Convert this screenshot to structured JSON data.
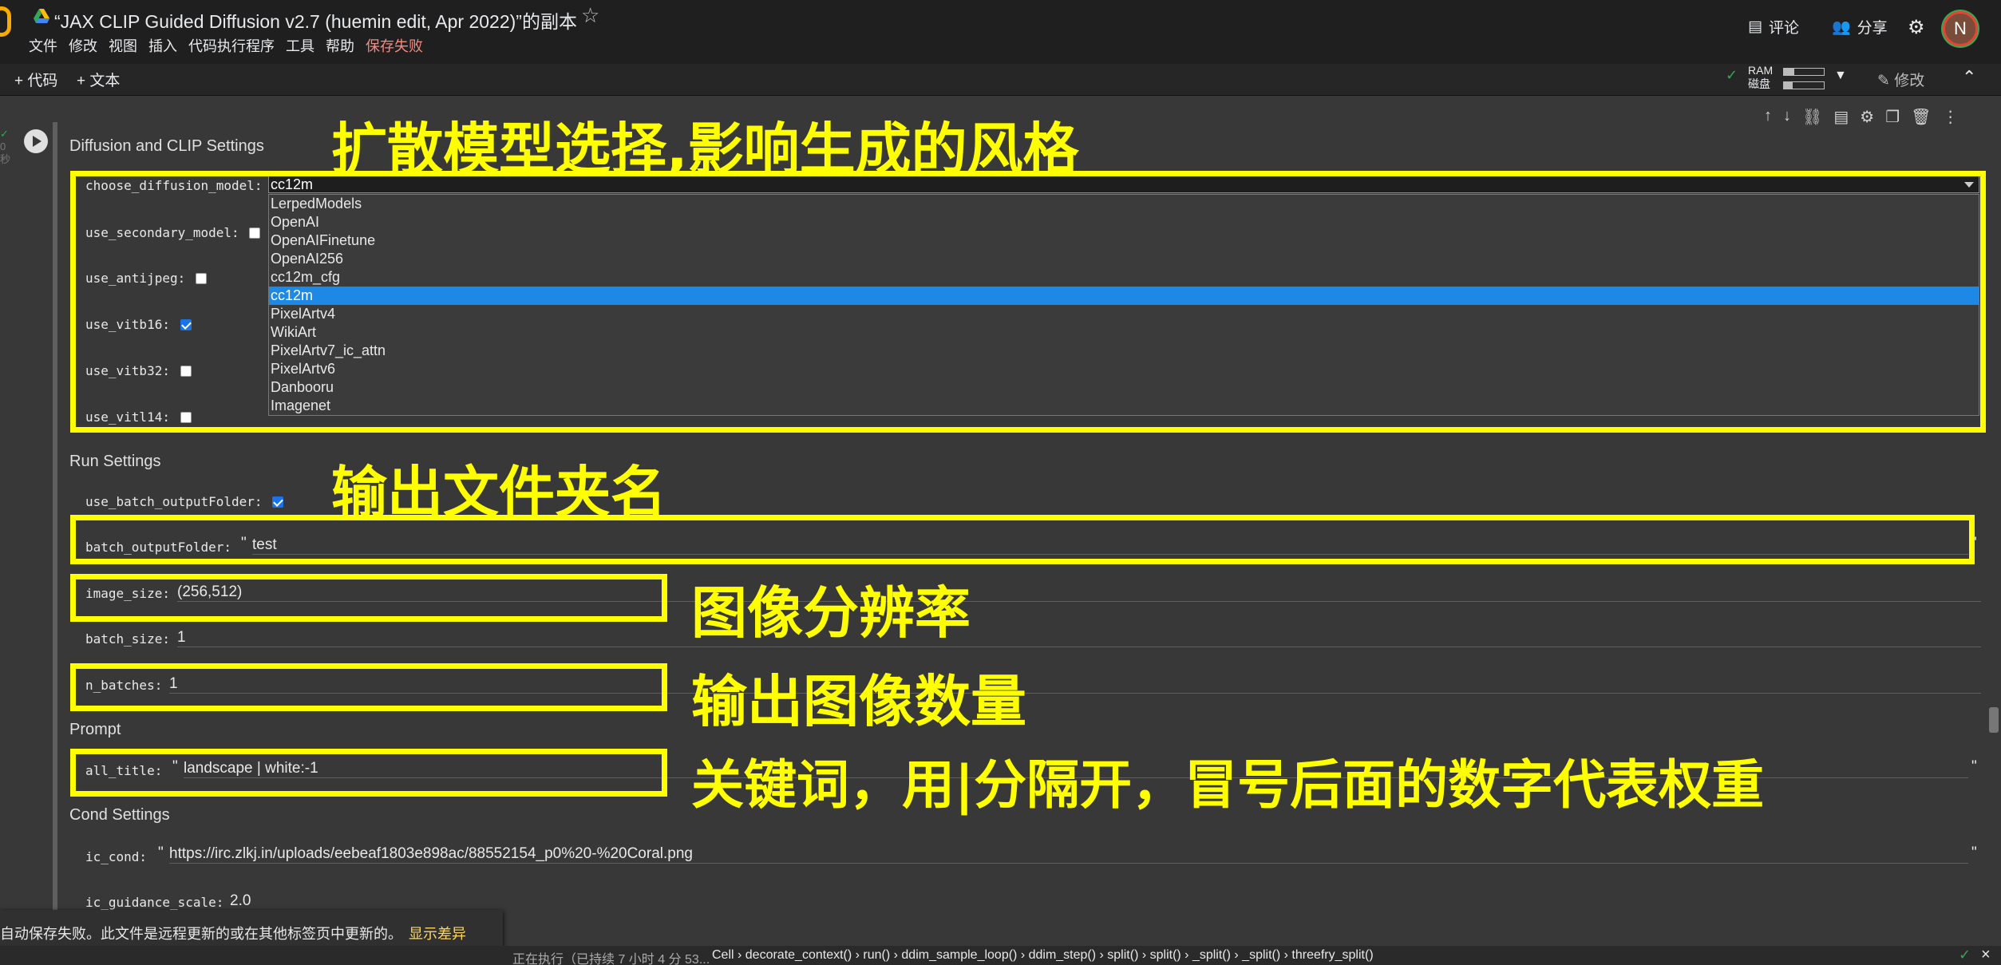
{
  "header": {
    "title": "“JAX CLIP Guided Diffusion v2.7 (huemin edit, Apr 2022)”的副本",
    "menu": [
      "文件",
      "修改",
      "视图",
      "插入",
      "代码执行程序",
      "工具",
      "帮助"
    ],
    "save_failed": "保存失败",
    "comment": "评论",
    "share": "分享",
    "avatar": "N"
  },
  "toolbar": {
    "add_code": "+ 代码",
    "add_text": "+ 文本",
    "ram": "RAM",
    "disk": "磁盘",
    "edit": "修改",
    "ram_usage": 0.25,
    "disk_usage": 0.22
  },
  "gutter": {
    "status": "✓",
    "time": "0",
    "unit": "秒"
  },
  "sections": {
    "diffusion": "Diffusion and CLIP Settings",
    "run": "Run Settings",
    "prompt": "Prompt",
    "cond": "Cond Settings"
  },
  "fields": {
    "choose_diffusion_model": "choose_diffusion_model:",
    "selected_model": "cc12m",
    "use_secondary_model": "use_secondary_model:",
    "use_antijpeg": "use_antijpeg:",
    "use_vitb16": "use_vitb16:",
    "use_vitb32": "use_vitb32:",
    "use_vitl14": "use_vitl14:",
    "use_batch_outputFolder": "use_batch_outputFolder:",
    "batch_outputFolder": "batch_outputFolder:",
    "batch_outputFolder_value": "test",
    "image_size": "image_size:",
    "image_size_value": "(256,512)",
    "batch_size": "batch_size:",
    "batch_size_value": "1",
    "n_batches": "n_batches:",
    "n_batches_value": "1",
    "all_title": "all_title:",
    "all_title_value": "landscape | white:-1",
    "ic_cond": "ic_cond:",
    "ic_cond_value": "https://irc.zlkj.in/uploads/eebeaf1803e898ac/88552154_p0%20-%20Coral.png",
    "ic_guidance_scale": "ic_guidance_scale:",
    "ic_guidance_scale_value": "2.0"
  },
  "model_options": [
    "LerpedModels",
    "OpenAI",
    "OpenAIFinetune",
    "OpenAI256",
    "cc12m_cfg",
    "cc12m",
    "PixelArtv4",
    "WikiArt",
    "PixelArtv7_ic_attn",
    "PixelArtv6",
    "Danbooru",
    "Imagenet"
  ],
  "annotations": {
    "model": "扩散模型选择,影响生成的风格",
    "folder": "输出文件夹名",
    "size": "图像分辨率",
    "count": "输出图像数量",
    "prompt": "关键词，用|分隔开，冒号后面的数字代表权重"
  },
  "toast": {
    "message": "自动保存失败。此文件是远程更新的或在其他标签页中更新的。",
    "link": "显示差异"
  },
  "statusbar": {
    "running": "正在执行（已持续 7 小时 4 分 53...",
    "trace": "Cell › decorate_context() › run() › ddim_sample_loop() › ddim_step() › split() › split() › _split() › _split() › threefry_split()"
  }
}
